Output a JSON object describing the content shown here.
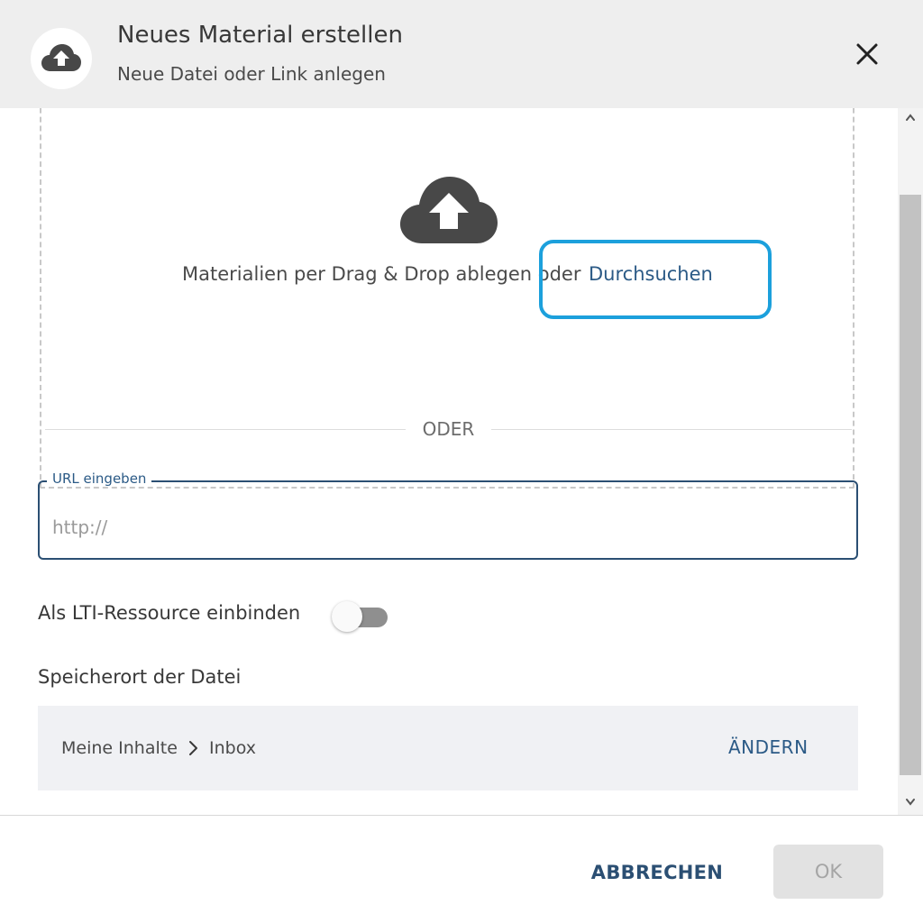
{
  "dialog": {
    "title": "Neues Material erstellen",
    "subtitle": "Neue Datei oder Link anlegen",
    "header_icon": "cloud-upload-icon",
    "close_icon": "close-icon"
  },
  "dropzone": {
    "icon": "cloud-upload-icon",
    "text": "Materialien per Drag & Drop ablegen oder",
    "browse_link": "Durchsuchen"
  },
  "divider": {
    "label": "ODER"
  },
  "url": {
    "label": "URL eingeben",
    "placeholder": "http://",
    "value": ""
  },
  "lti": {
    "label": "Als LTI-Ressource einbinden",
    "enabled": false
  },
  "storage": {
    "title": "Speicherort der Datei",
    "breadcrumb": [
      "Meine Inhalte",
      "Inbox"
    ],
    "change_label": "ÄNDERN"
  },
  "footer": {
    "cancel_label": "ABBRECHEN",
    "ok_label": "OK"
  },
  "colors": {
    "accent": "#2b5a86",
    "highlight": "#1ca0dc",
    "header_bg": "#eeeeee",
    "icon": "#484848"
  }
}
